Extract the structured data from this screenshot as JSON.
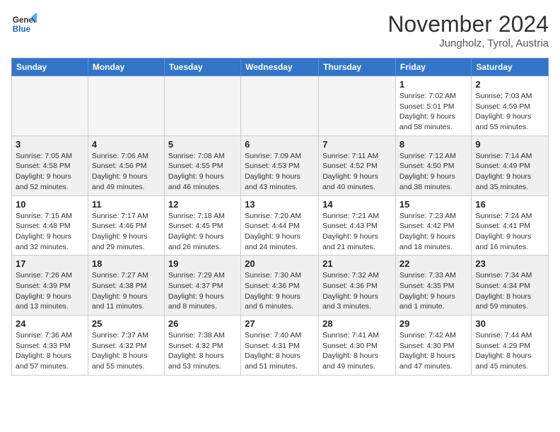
{
  "header": {
    "logo_line1": "General",
    "logo_line2": "Blue",
    "month_title": "November 2024",
    "subtitle": "Jungholz, Tyrol, Austria"
  },
  "weekdays": [
    "Sunday",
    "Monday",
    "Tuesday",
    "Wednesday",
    "Thursday",
    "Friday",
    "Saturday"
  ],
  "weeks": [
    [
      {
        "day": "",
        "info": ""
      },
      {
        "day": "",
        "info": ""
      },
      {
        "day": "",
        "info": ""
      },
      {
        "day": "",
        "info": ""
      },
      {
        "day": "",
        "info": ""
      },
      {
        "day": "1",
        "info": "Sunrise: 7:02 AM\nSunset: 5:01 PM\nDaylight: 9 hours and 58 minutes."
      },
      {
        "day": "2",
        "info": "Sunrise: 7:03 AM\nSunset: 4:59 PM\nDaylight: 9 hours and 55 minutes."
      }
    ],
    [
      {
        "day": "3",
        "info": "Sunrise: 7:05 AM\nSunset: 4:58 PM\nDaylight: 9 hours and 52 minutes."
      },
      {
        "day": "4",
        "info": "Sunrise: 7:06 AM\nSunset: 4:56 PM\nDaylight: 9 hours and 49 minutes."
      },
      {
        "day": "5",
        "info": "Sunrise: 7:08 AM\nSunset: 4:55 PM\nDaylight: 9 hours and 46 minutes."
      },
      {
        "day": "6",
        "info": "Sunrise: 7:09 AM\nSunset: 4:53 PM\nDaylight: 9 hours and 43 minutes."
      },
      {
        "day": "7",
        "info": "Sunrise: 7:11 AM\nSunset: 4:52 PM\nDaylight: 9 hours and 40 minutes."
      },
      {
        "day": "8",
        "info": "Sunrise: 7:12 AM\nSunset: 4:50 PM\nDaylight: 9 hours and 38 minutes."
      },
      {
        "day": "9",
        "info": "Sunrise: 7:14 AM\nSunset: 4:49 PM\nDaylight: 9 hours and 35 minutes."
      }
    ],
    [
      {
        "day": "10",
        "info": "Sunrise: 7:15 AM\nSunset: 4:48 PM\nDaylight: 9 hours and 32 minutes."
      },
      {
        "day": "11",
        "info": "Sunrise: 7:17 AM\nSunset: 4:46 PM\nDaylight: 9 hours and 29 minutes."
      },
      {
        "day": "12",
        "info": "Sunrise: 7:18 AM\nSunset: 4:45 PM\nDaylight: 9 hours and 26 minutes."
      },
      {
        "day": "13",
        "info": "Sunrise: 7:20 AM\nSunset: 4:44 PM\nDaylight: 9 hours and 24 minutes."
      },
      {
        "day": "14",
        "info": "Sunrise: 7:21 AM\nSunset: 4:43 PM\nDaylight: 9 hours and 21 minutes."
      },
      {
        "day": "15",
        "info": "Sunrise: 7:23 AM\nSunset: 4:42 PM\nDaylight: 9 hours and 18 minutes."
      },
      {
        "day": "16",
        "info": "Sunrise: 7:24 AM\nSunset: 4:41 PM\nDaylight: 9 hours and 16 minutes."
      }
    ],
    [
      {
        "day": "17",
        "info": "Sunrise: 7:26 AM\nSunset: 4:39 PM\nDaylight: 9 hours and 13 minutes."
      },
      {
        "day": "18",
        "info": "Sunrise: 7:27 AM\nSunset: 4:38 PM\nDaylight: 9 hours and 11 minutes."
      },
      {
        "day": "19",
        "info": "Sunrise: 7:29 AM\nSunset: 4:37 PM\nDaylight: 9 hours and 8 minutes."
      },
      {
        "day": "20",
        "info": "Sunrise: 7:30 AM\nSunset: 4:36 PM\nDaylight: 9 hours and 6 minutes."
      },
      {
        "day": "21",
        "info": "Sunrise: 7:32 AM\nSunset: 4:36 PM\nDaylight: 9 hours and 3 minutes."
      },
      {
        "day": "22",
        "info": "Sunrise: 7:33 AM\nSunset: 4:35 PM\nDaylight: 9 hours and 1 minute."
      },
      {
        "day": "23",
        "info": "Sunrise: 7:34 AM\nSunset: 4:34 PM\nDaylight: 8 hours and 59 minutes."
      }
    ],
    [
      {
        "day": "24",
        "info": "Sunrise: 7:36 AM\nSunset: 4:33 PM\nDaylight: 8 hours and 57 minutes."
      },
      {
        "day": "25",
        "info": "Sunrise: 7:37 AM\nSunset: 4:32 PM\nDaylight: 8 hours and 55 minutes."
      },
      {
        "day": "26",
        "info": "Sunrise: 7:38 AM\nSunset: 4:32 PM\nDaylight: 8 hours and 53 minutes."
      },
      {
        "day": "27",
        "info": "Sunrise: 7:40 AM\nSunset: 4:31 PM\nDaylight: 8 hours and 51 minutes."
      },
      {
        "day": "28",
        "info": "Sunrise: 7:41 AM\nSunset: 4:30 PM\nDaylight: 8 hours and 49 minutes."
      },
      {
        "day": "29",
        "info": "Sunrise: 7:42 AM\nSunset: 4:30 PM\nDaylight: 8 hours and 47 minutes."
      },
      {
        "day": "30",
        "info": "Sunrise: 7:44 AM\nSunset: 4:29 PM\nDaylight: 8 hours and 45 minutes."
      }
    ]
  ]
}
